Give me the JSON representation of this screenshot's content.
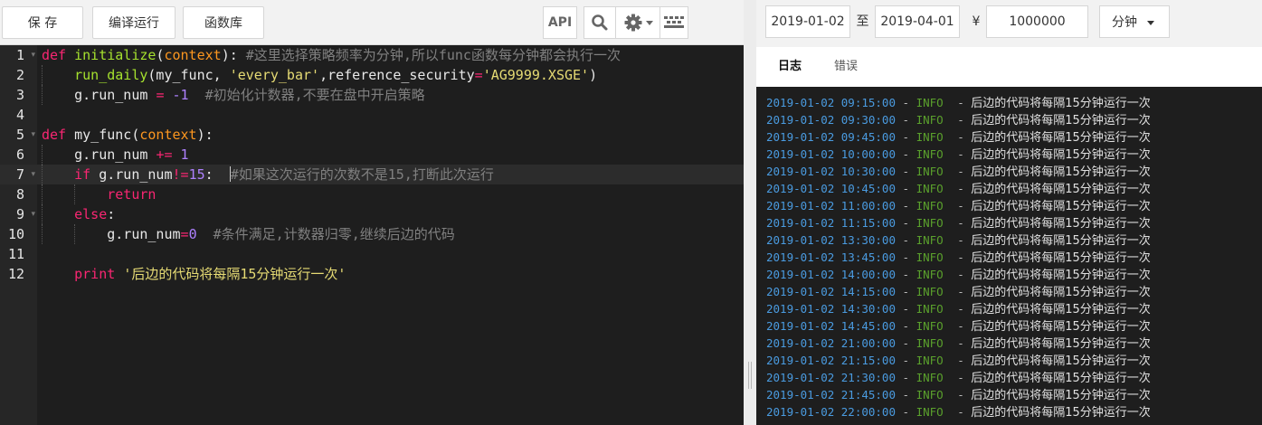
{
  "toolbar": {
    "save_label": "保 存",
    "run_label": "编译运行",
    "lib_label": "函数库",
    "api_label": "API",
    "collapse_label": "»"
  },
  "editor": {
    "line_numbers": [
      "1",
      "2",
      "3",
      "4",
      "5",
      "6",
      "7",
      "8",
      "9",
      "10",
      "11",
      "12"
    ],
    "lines": {
      "l1": {
        "kw": "def",
        "fn": "initialize",
        "p1": "(",
        "param": "context",
        "p2": "):",
        "cm": " #这里选择策略频率为分钟,所以func函数每分钟都会执行一次"
      },
      "l2": {
        "fn": "run_daily",
        "a": "(my_func, ",
        "str1": "'every_bar'",
        "b": ",reference_security",
        "op": "=",
        "str2": "'AG9999.XSGE'",
        "c": ")"
      },
      "l3": {
        "a": "g.run_num ",
        "op": "=",
        "num": " -1",
        "cm": "  #初始化计数器,不要在盘中开启策略"
      },
      "l5": {
        "kw": "def",
        "a": " my_func(",
        "param": "context",
        "b": "):"
      },
      "l6": {
        "a": "g.run_num ",
        "op": "+=",
        "num": " 1"
      },
      "l7": {
        "kw": "if",
        "a": " g.run_num",
        "op": "!=",
        "num": "15",
        "b": ":  ",
        "cm": "#如果这次运行的次数不是15,打断此次运行"
      },
      "l8": {
        "kw": "return"
      },
      "l9": {
        "kw": "else",
        "b": ":"
      },
      "l10": {
        "a": "g.run_num",
        "op": "=",
        "num": "0",
        "cm": "  #条件满足,计数器归零,继续后边的代码"
      },
      "l12": {
        "kw": "print",
        "str": "'后边的代码将每隔15分钟运行一次'"
      }
    }
  },
  "settings": {
    "start_date": "2019-01-02",
    "to_label": "至",
    "end_date": "2019-04-01",
    "currency_symbol": "¥",
    "capital": "1000000",
    "frequency": "分钟"
  },
  "tabs": {
    "log": "日志",
    "error": "错误"
  },
  "log": {
    "level": "INFO",
    "separator": " - ",
    "message": "后边的代码将每隔15分钟运行一次",
    "timestamps": [
      "2019-01-02 09:15:00",
      "2019-01-02 09:30:00",
      "2019-01-02 09:45:00",
      "2019-01-02 10:00:00",
      "2019-01-02 10:30:00",
      "2019-01-02 10:45:00",
      "2019-01-02 11:00:00",
      "2019-01-02 11:15:00",
      "2019-01-02 13:30:00",
      "2019-01-02 13:45:00",
      "2019-01-02 14:00:00",
      "2019-01-02 14:15:00",
      "2019-01-02 14:30:00",
      "2019-01-02 14:45:00",
      "2019-01-02 21:00:00",
      "2019-01-02 21:15:00",
      "2019-01-02 21:30:00",
      "2019-01-02 21:45:00",
      "2019-01-02 22:00:00"
    ]
  },
  "colors": {
    "keyword": "#f92672",
    "function": "#a6e22e",
    "parameter": "#fd971f",
    "string": "#e6db74",
    "number": "#ae81ff",
    "comment": "#808080",
    "log_timestamp": "#4a9be0",
    "log_level": "#5aa02c"
  }
}
